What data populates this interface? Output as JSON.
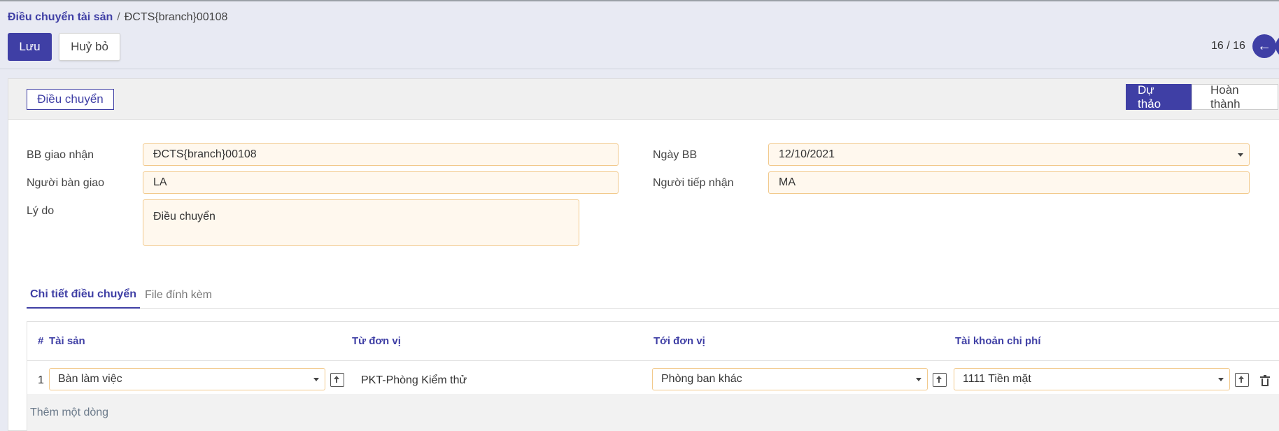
{
  "breadcrumb": {
    "parent": "Điều chuyển tài sản",
    "separator": "/",
    "current": "ĐCTS{branch}00108"
  },
  "toolbar": {
    "save_label": "Lưu",
    "discard_label": "Huỷ bỏ"
  },
  "pager": {
    "value": "16 / 16"
  },
  "header": {
    "action_button": "Điều chuyển",
    "statuses": [
      {
        "label": "Dự thảo",
        "active": true
      },
      {
        "label": "Hoàn thành",
        "active": false
      }
    ]
  },
  "form": {
    "bb_label": "BB giao nhận",
    "bb_value": "ĐCTS{branch}00108",
    "sender_label": "Người bàn giao",
    "sender_value": "LA",
    "reason_label": "Lý do",
    "reason_value": "Điều chuyển",
    "date_label": "Ngày BB",
    "date_value": "12/10/2021",
    "receiver_label": "Người tiếp nhận",
    "receiver_value": "MA"
  },
  "tabs": [
    {
      "label": "Chi tiết điều chuyển"
    },
    {
      "label": "File đính kèm"
    }
  ],
  "table": {
    "columns": [
      "#",
      "Tài sản",
      "Từ đơn vị",
      "Tới đơn vị",
      "Tài khoản chi phí"
    ],
    "rows": [
      {
        "num": "1",
        "asset": "Bàn làm việc",
        "from_unit": "PKT-Phòng Kiểm thử",
        "to_unit": "Phòng ban khác",
        "account": "1111 Tiền mặt"
      }
    ],
    "add_line": "Thêm một dòng"
  },
  "colors": {
    "primary": "#3f3fa5",
    "field_border": "#f2c98b",
    "field_bg": "#fff8ee"
  }
}
